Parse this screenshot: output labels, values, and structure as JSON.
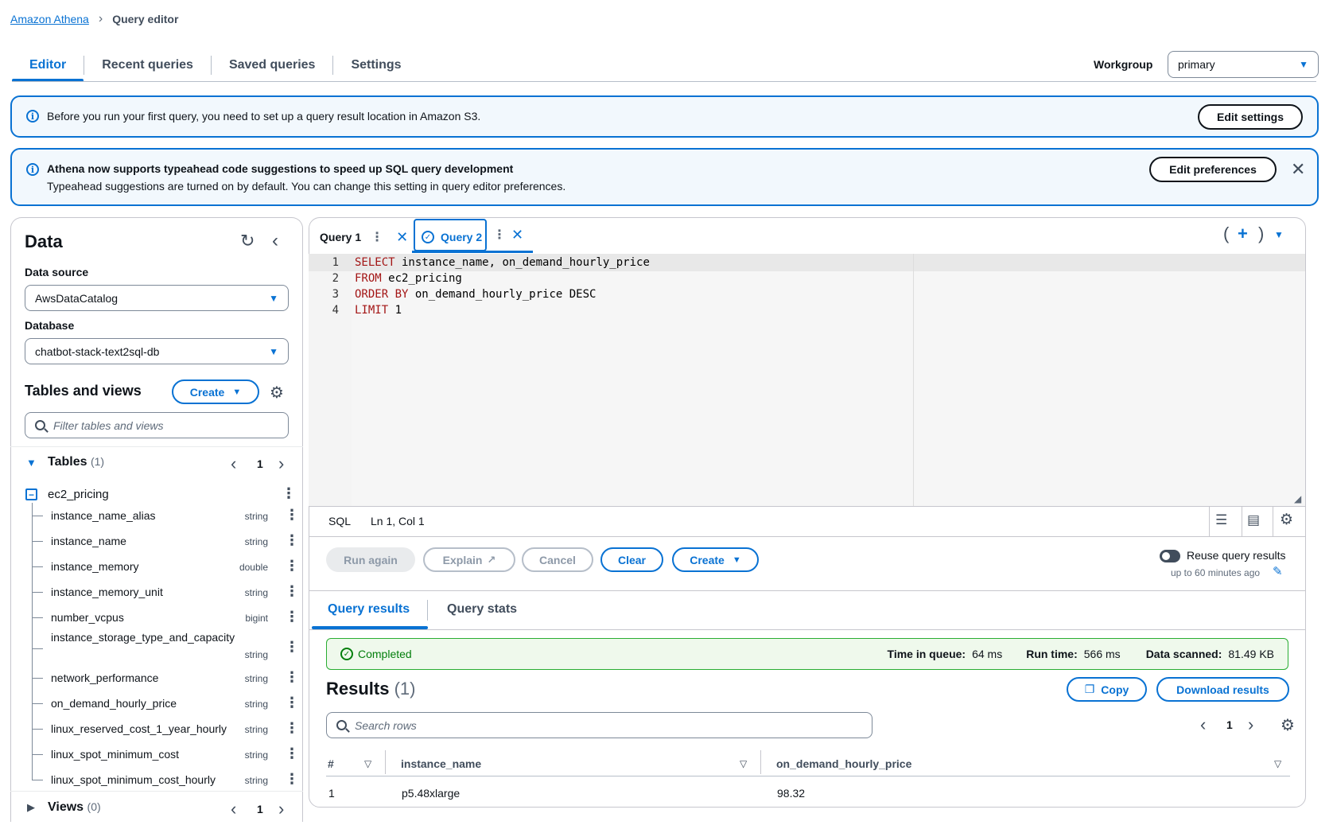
{
  "breadcrumb": {
    "root": "Amazon Athena",
    "current": "Query editor"
  },
  "tabs": [
    "Editor",
    "Recent queries",
    "Saved queries",
    "Settings"
  ],
  "workgroup": {
    "label": "Workgroup",
    "value": "primary"
  },
  "banner1": {
    "text": "Before you run your first query, you need to set up a query result location in Amazon S3.",
    "button": "Edit settings"
  },
  "banner2": {
    "title": "Athena now supports typeahead code suggestions to speed up SQL query development",
    "text": "Typeahead suggestions are turned on by default. You can change this setting in query editor preferences.",
    "button": "Edit preferences"
  },
  "data_panel": {
    "title": "Data",
    "data_source_label": "Data source",
    "data_source": "AwsDataCatalog",
    "database_label": "Database",
    "database": "chatbot-stack-text2sql-db",
    "tables_views_label": "Tables and views",
    "create_label": "Create",
    "filter_placeholder": "Filter tables and views",
    "tables_label": "Tables",
    "tables_count": "(1)",
    "tables_page": "1",
    "table_name": "ec2_pricing",
    "columns": [
      {
        "name": "instance_name_alias",
        "type": "string"
      },
      {
        "name": "instance_name",
        "type": "string"
      },
      {
        "name": "instance_memory",
        "type": "double"
      },
      {
        "name": "instance_memory_unit",
        "type": "string"
      },
      {
        "name": "number_vcpus",
        "type": "bigint"
      },
      {
        "name": "instance_storage_type_and_capacity",
        "type": "string"
      },
      {
        "name": "network_performance",
        "type": "string"
      },
      {
        "name": "on_demand_hourly_price",
        "type": "string"
      },
      {
        "name": "linux_reserved_cost_1_year_hourly",
        "type": "string"
      },
      {
        "name": "linux_spot_minimum_cost",
        "type": "string"
      },
      {
        "name": "linux_spot_minimum_cost_hourly",
        "type": "string"
      }
    ],
    "views_label": "Views",
    "views_count": "(0)",
    "views_page": "1"
  },
  "editor": {
    "tab1": "Query 1",
    "tab2": "Query 2",
    "line_numbers": [
      "1",
      "2",
      "3",
      "4"
    ],
    "lines": [
      {
        "kw": "SELECT",
        "rest": " instance_name, on_demand_hourly_price"
      },
      {
        "kw": "FROM",
        "rest": " ec2_pricing"
      },
      {
        "kw": "ORDER BY",
        "rest": " on_demand_hourly_price DESC"
      },
      {
        "kw": "LIMIT",
        "rest": " 1"
      }
    ],
    "lang": "SQL",
    "cursor": "Ln 1, Col 1",
    "buttons": {
      "run": "Run again",
      "explain": "Explain",
      "cancel": "Cancel",
      "clear": "Clear",
      "create": "Create"
    },
    "reuse_label": "Reuse query results",
    "reuse_sub": "up to 60 minutes ago"
  },
  "results": {
    "tab_results": "Query results",
    "tab_stats": "Query stats",
    "status": "Completed",
    "queue_label": "Time in queue:",
    "queue_value": "64 ms",
    "run_label": "Run time:",
    "run_value": "566 ms",
    "scanned_label": "Data scanned:",
    "scanned_value": "81.49 KB",
    "title": "Results",
    "count": "(1)",
    "copy": "Copy",
    "download": "Download results",
    "search_placeholder": "Search rows",
    "page": "1",
    "headers": [
      "#",
      "instance_name",
      "on_demand_hourly_price"
    ],
    "rows": [
      [
        "1",
        "p5.48xlarge",
        "98.32"
      ]
    ]
  }
}
